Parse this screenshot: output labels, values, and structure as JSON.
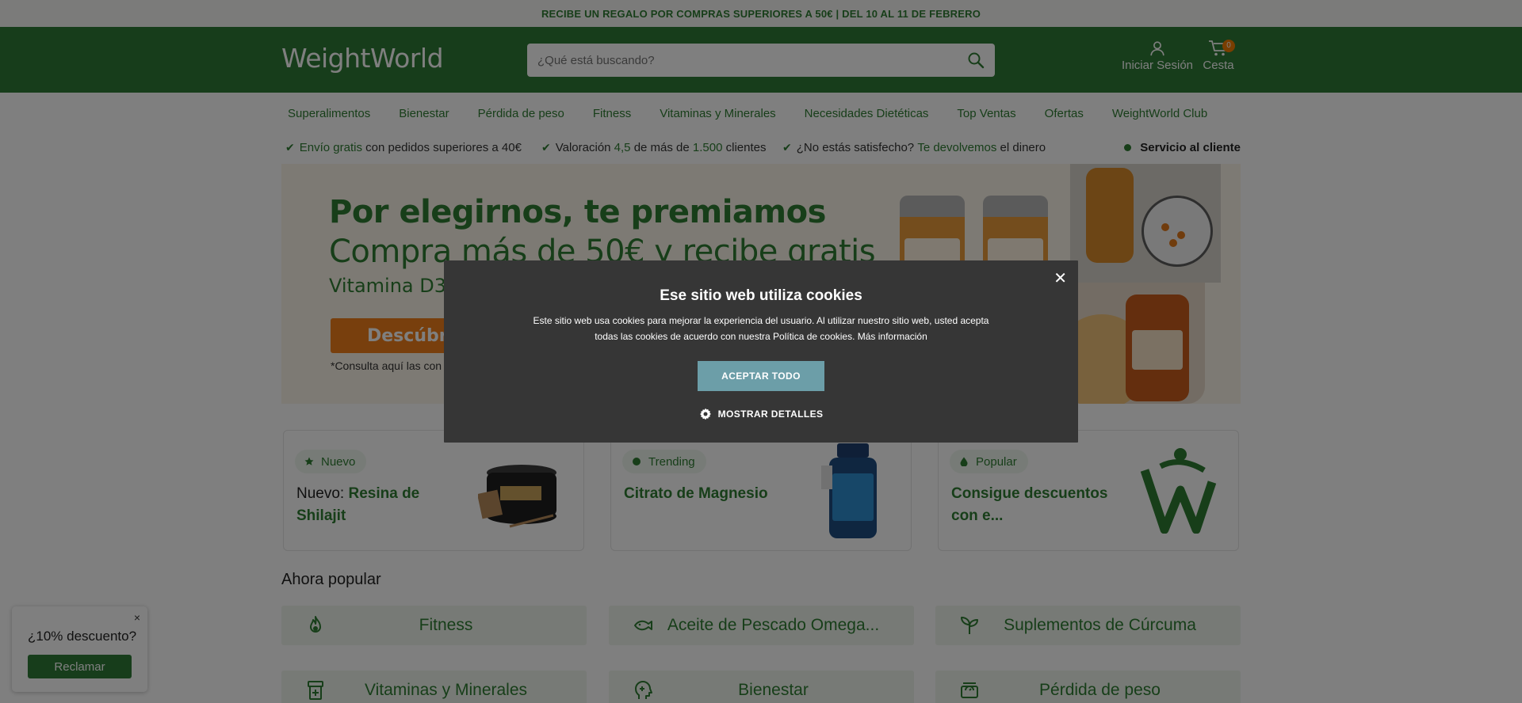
{
  "promo_bar": {
    "text": "RECIBE UN REGALO POR COMPRAS SUPERIORES A 50€ | DEL 10 AL 11 DE FEBRERO"
  },
  "header": {
    "logo": "WeightWorld",
    "search_placeholder": "¿Qué está buscando?",
    "account_label": "Iniciar Sesión",
    "cart_label": "Cesta",
    "cart_count": "0"
  },
  "nav": {
    "items": [
      {
        "label": "Superalimentos"
      },
      {
        "label": "Bienestar"
      },
      {
        "label": "Pérdida de peso"
      },
      {
        "label": "Fitness"
      },
      {
        "label": "Vitaminas y Minerales"
      },
      {
        "label": "Necesidades Dietéticas"
      },
      {
        "label": "Top Ventas"
      },
      {
        "label": "Ofertas"
      },
      {
        "label": "WeightWorld Club"
      }
    ]
  },
  "usps": {
    "usp1": {
      "hl": "Envío gratis",
      "rest": " con pedidos superiores a 40€"
    },
    "usp2": {
      "a": "Valoración ",
      "b": "4,5",
      "c": " de más de ",
      "d": "1.500",
      "e": " clientes"
    },
    "usp3": {
      "a": "¿No estás satisfecho? ",
      "b": "Te devolvemos",
      "c": " el dinero"
    },
    "service": "Servicio al cliente"
  },
  "hero": {
    "heading": "Por elegirnos, te premiamos",
    "subheading": "Compra más de 50€ y recibe gratis",
    "product": "Vitamina D3",
    "button": "Descúbre",
    "note": "*Consulta aquí las con"
  },
  "cards": [
    {
      "tag": "Nuevo",
      "title_prefix": "Nuevo: ",
      "title": "Resina de Shilajit"
    },
    {
      "tag": "Trending",
      "title_prefix": "",
      "title": "Citrato de Magnesio"
    },
    {
      "tag": "Popular",
      "title_prefix": "",
      "title": "Consigue descuentos con e..."
    }
  ],
  "popular": {
    "title": "Ahora popular",
    "categories": [
      {
        "label": "Fitness",
        "icon": "flame-icon"
      },
      {
        "label": "Aceite de Pescado Omega...",
        "icon": "fish-icon"
      },
      {
        "label": "Suplementos de Cúrcuma",
        "icon": "sprout-icon"
      },
      {
        "label": "Vitaminas y Minerales",
        "icon": "pill-bottle-icon"
      },
      {
        "label": "Bienestar",
        "icon": "head-icon"
      },
      {
        "label": "Pérdida de peso",
        "icon": "scale-icon"
      }
    ]
  },
  "discount_popup": {
    "close": "×",
    "text": "¿10% descuento?",
    "button": "Reclamar"
  },
  "cookie_modal": {
    "close": "✕",
    "title": "Ese sitio web utiliza cookies",
    "body": "Este sitio web usa cookies para mejorar la experiencia del usuario. Al utilizar nuestro sitio web, usted acepta todas las cookies de acuerdo con nuestra Política de cookies. Más información",
    "accept": "ACEPTAR TODO",
    "details": "MOSTRAR DETALLES"
  },
  "colors": {
    "brand_green": "#2f7a37",
    "accent_orange": "#f07f1a",
    "modal_bg": "#363636",
    "accept_button": "#6c9ea8"
  }
}
